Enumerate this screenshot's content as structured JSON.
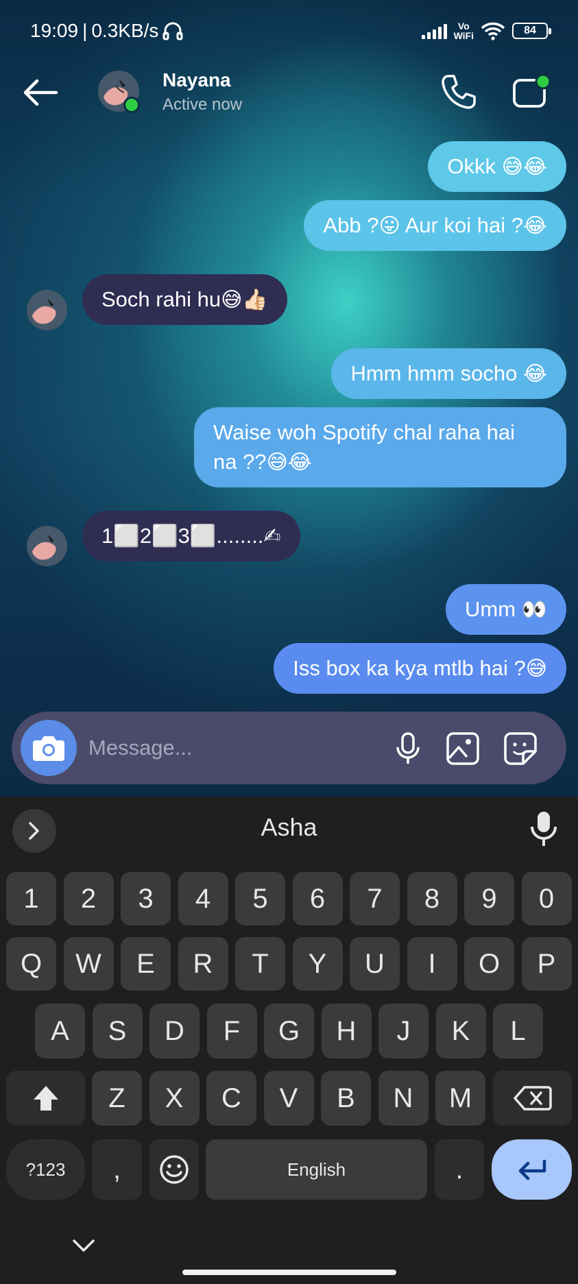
{
  "status_bar": {
    "time": "19:09",
    "separator": "|",
    "speed": "0.3KB/s",
    "vowifi_top": "Vo",
    "vowifi_bottom": "WiFi",
    "battery": "84"
  },
  "header": {
    "contact_name": "Nayana",
    "status": "Active now"
  },
  "messages": [
    {
      "direction": "out",
      "text": "Okkk",
      "emoji": "😅😂"
    },
    {
      "direction": "out",
      "text_a": "Abb ?",
      "emoji_a": "😛",
      "text_b": " Aur koi hai ?",
      "emoji_b": "😂"
    },
    {
      "direction": "in",
      "text": "Soch rahi hu",
      "emoji": "😅👍🏻"
    },
    {
      "direction": "out",
      "text": "Hmm hmm socho ",
      "emoji": "😂"
    },
    {
      "direction": "out",
      "line1": "Waise woh Spotify chal raha hai",
      "line2": "na ??",
      "emoji": "😅😂"
    },
    {
      "direction": "in",
      "text": "1⬜2⬜3⬜........",
      "emoji": "✍"
    },
    {
      "direction": "out",
      "text": "Umm ",
      "emoji": "👀"
    },
    {
      "direction": "out",
      "text": "Iss box ka kya mtlb hai ?",
      "emoji": "😅"
    }
  ],
  "composer": {
    "placeholder": "Message..."
  },
  "keyboard": {
    "suggestion": "Asha",
    "number_row": [
      "1",
      "2",
      "3",
      "4",
      "5",
      "6",
      "7",
      "8",
      "9",
      "0"
    ],
    "row1": [
      "Q",
      "W",
      "E",
      "R",
      "T",
      "Y",
      "U",
      "I",
      "O",
      "P"
    ],
    "row2": [
      "A",
      "S",
      "D",
      "F",
      "G",
      "H",
      "J",
      "K",
      "L"
    ],
    "row3": [
      "Z",
      "X",
      "C",
      "V",
      "B",
      "N",
      "M"
    ],
    "symbols_key": "?123",
    "comma_key": ",",
    "space_key": "English",
    "period_key": "."
  },
  "colors": {
    "outgoing_top": "#5ec8e8",
    "outgoing_bottom": "#5a8cef",
    "incoming": "#2f2d52",
    "composer": "#4a4a6a",
    "camera_button": "#5b8de8",
    "enter_key": "#a8c7fa",
    "online": "#2ecc40"
  },
  "icons": {
    "back": "arrow-left-icon",
    "call": "phone-icon",
    "video": "video-camera-icon",
    "camera": "camera-icon",
    "mic": "microphone-icon",
    "gallery": "image-icon",
    "sticker": "sticker-icon",
    "shift": "shift-icon",
    "backspace": "backspace-icon",
    "emoji": "emoji-icon",
    "enter": "enter-icon",
    "expand": "chevron-right-icon",
    "hide_keyboard": "chevron-down-icon"
  }
}
